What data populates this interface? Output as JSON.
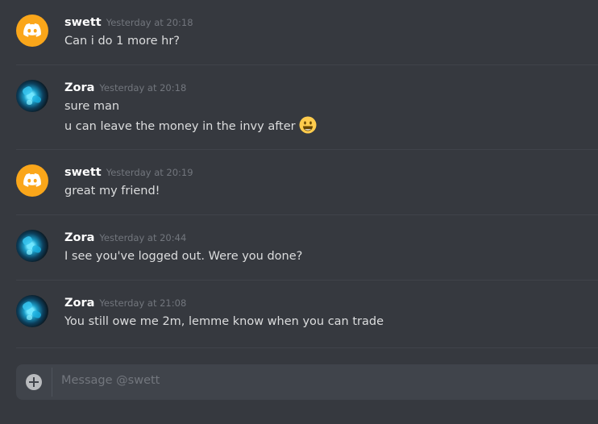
{
  "messages": [
    {
      "author": "swett",
      "timestamp": "Yesterday at 20:18",
      "avatar": "discord-logo-icon",
      "lines": [
        "Can i do 1 more hr?"
      ]
    },
    {
      "author": "Zora",
      "timestamp": "Yesterday at 20:18",
      "avatar": "zora-avatar",
      "lines": [
        "sure man",
        "u can leave the money in the invy after"
      ],
      "emoji": "smiley-emoji-icon"
    },
    {
      "author": "swett",
      "timestamp": "Yesterday at 20:19",
      "avatar": "discord-logo-icon",
      "lines": [
        "great my friend!"
      ]
    },
    {
      "author": "Zora",
      "timestamp": "Yesterday at 20:44",
      "avatar": "zora-avatar",
      "lines": [
        "I see you've logged out. Were you done?"
      ]
    },
    {
      "author": "Zora",
      "timestamp": "Yesterday at 21:08",
      "avatar": "zora-avatar",
      "lines": [
        "You still owe me 2m, lemme know when you can trade"
      ]
    }
  ],
  "composer": {
    "placeholder": "Message @swett",
    "add_icon": "plus-circle-icon"
  },
  "colors": {
    "background": "#36393f",
    "discord_avatar": "#faa61a",
    "author": "#ffffff",
    "timestamp": "#72767d",
    "message_text": "#dcddde",
    "composer_bg": "#40444b"
  }
}
